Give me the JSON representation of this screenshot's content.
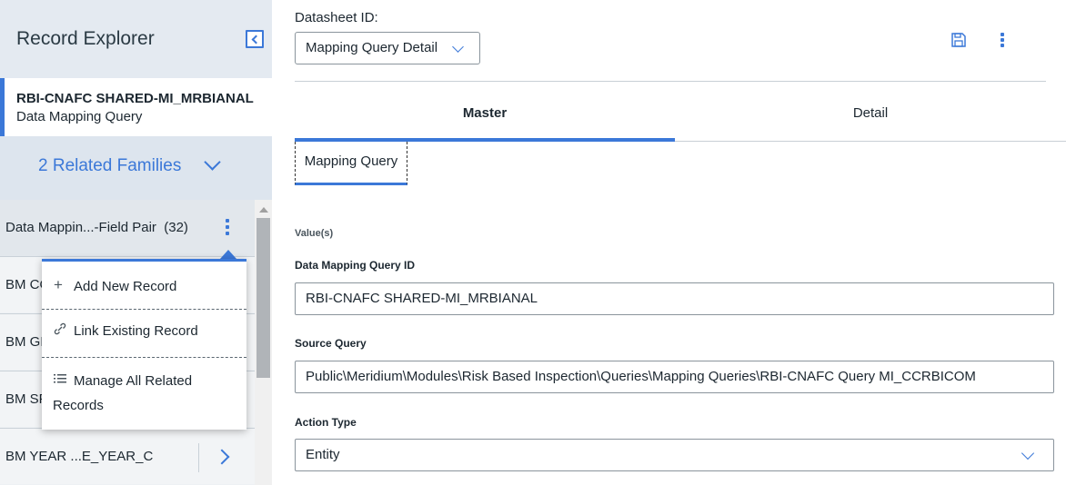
{
  "explorer": {
    "title": "Record Explorer",
    "collapse_icon": "collapse-left-icon"
  },
  "record": {
    "id": "RBI-CNAFC SHARED-MI_MRBIANAL",
    "family": "Data Mapping Query"
  },
  "related": {
    "label": "2 Related Families"
  },
  "family_group": {
    "label": "Data Mappin...-Field Pair",
    "count": "(32)"
  },
  "records": [
    {
      "label": "BM CO"
    },
    {
      "label": "BM GR"
    },
    {
      "label": "BM SP"
    },
    {
      "label": "BM YEAR ...E_YEAR_C"
    }
  ],
  "popup_menu": {
    "items": [
      {
        "icon": "plus-icon",
        "label": "Add New Record"
      },
      {
        "icon": "link-icon",
        "label": "Link Existing Record"
      },
      {
        "icon": "list-icon",
        "label": "Manage All Related Records"
      }
    ]
  },
  "datasheet": {
    "label": "Datasheet ID:",
    "selected": "Mapping Query Detail"
  },
  "toolbar": {
    "save_icon": "save-icon",
    "more_icon": "more-options-icon"
  },
  "tabs": [
    {
      "label": "Master",
      "active": true
    },
    {
      "label": "Detail",
      "active": false
    }
  ],
  "subtab": {
    "label": "Mapping Query"
  },
  "form": {
    "section": "Value(s)",
    "fields": [
      {
        "label": "Data Mapping Query ID",
        "value": "RBI-CNAFC SHARED-MI_MRBIANAL"
      },
      {
        "label": "Source Query",
        "value": "Public\\Meridium\\Modules\\Risk Based Inspection\\Queries\\Mapping Queries\\RBI-CNAFC Query MI_CCRBICOM"
      },
      {
        "label": "Action Type",
        "value": "Entity"
      }
    ]
  },
  "colors": {
    "accent": "#3b78d8",
    "panel_bg": "#e9eef3"
  }
}
